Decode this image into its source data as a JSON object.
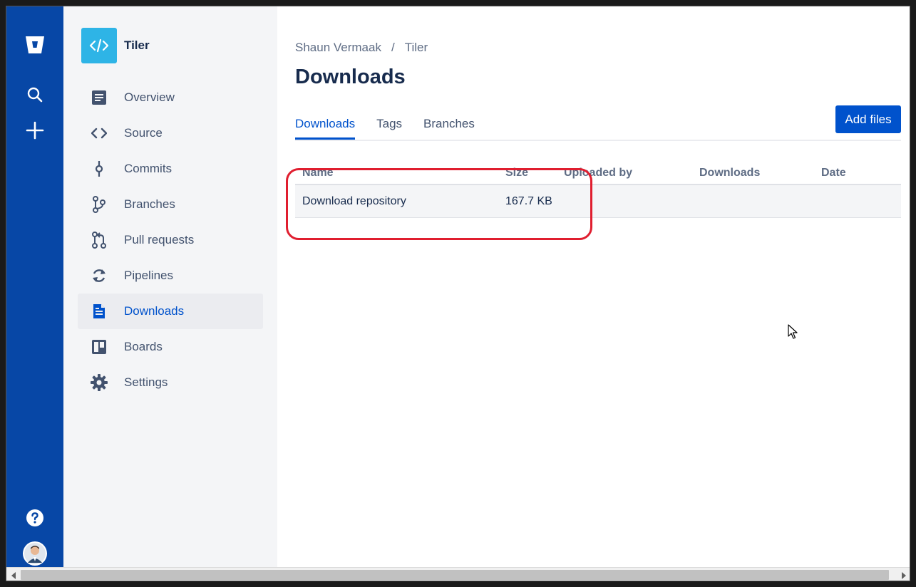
{
  "global_nav": {
    "logo": "bitbucket-logo",
    "icons": [
      "search-icon",
      "plus-icon",
      "help-icon",
      "avatar"
    ]
  },
  "project": {
    "name": "Tiler",
    "avatar_icon": "code-icon"
  },
  "sidebar": {
    "items": [
      {
        "label": "Overview",
        "icon": "overview-icon"
      },
      {
        "label": "Source",
        "icon": "source-icon"
      },
      {
        "label": "Commits",
        "icon": "commits-icon"
      },
      {
        "label": "Branches",
        "icon": "branches-icon"
      },
      {
        "label": "Pull requests",
        "icon": "pull-requests-icon"
      },
      {
        "label": "Pipelines",
        "icon": "pipelines-icon"
      },
      {
        "label": "Downloads",
        "icon": "downloads-icon",
        "active": true
      },
      {
        "label": "Boards",
        "icon": "boards-icon"
      },
      {
        "label": "Settings",
        "icon": "settings-icon"
      }
    ]
  },
  "breadcrumb": {
    "owner": "Shaun Vermaak",
    "separator": "/",
    "repo": "Tiler"
  },
  "page": {
    "title": "Downloads"
  },
  "tabs": [
    {
      "label": "Downloads",
      "active": true
    },
    {
      "label": "Tags"
    },
    {
      "label": "Branches"
    }
  ],
  "actions": {
    "add_files": "Add files"
  },
  "table": {
    "headers": [
      "Name",
      "Size",
      "Uploaded by",
      "Downloads",
      "Date"
    ],
    "rows": [
      {
        "name": "Download repository",
        "size": "167.7 KB",
        "uploaded_by": "",
        "downloads": "",
        "date": ""
      }
    ]
  },
  "colors": {
    "global_nav": "#0747a6",
    "primary": "#0052cc",
    "project_avatar": "#2eb4e6",
    "highlight": "#e01e2f"
  }
}
